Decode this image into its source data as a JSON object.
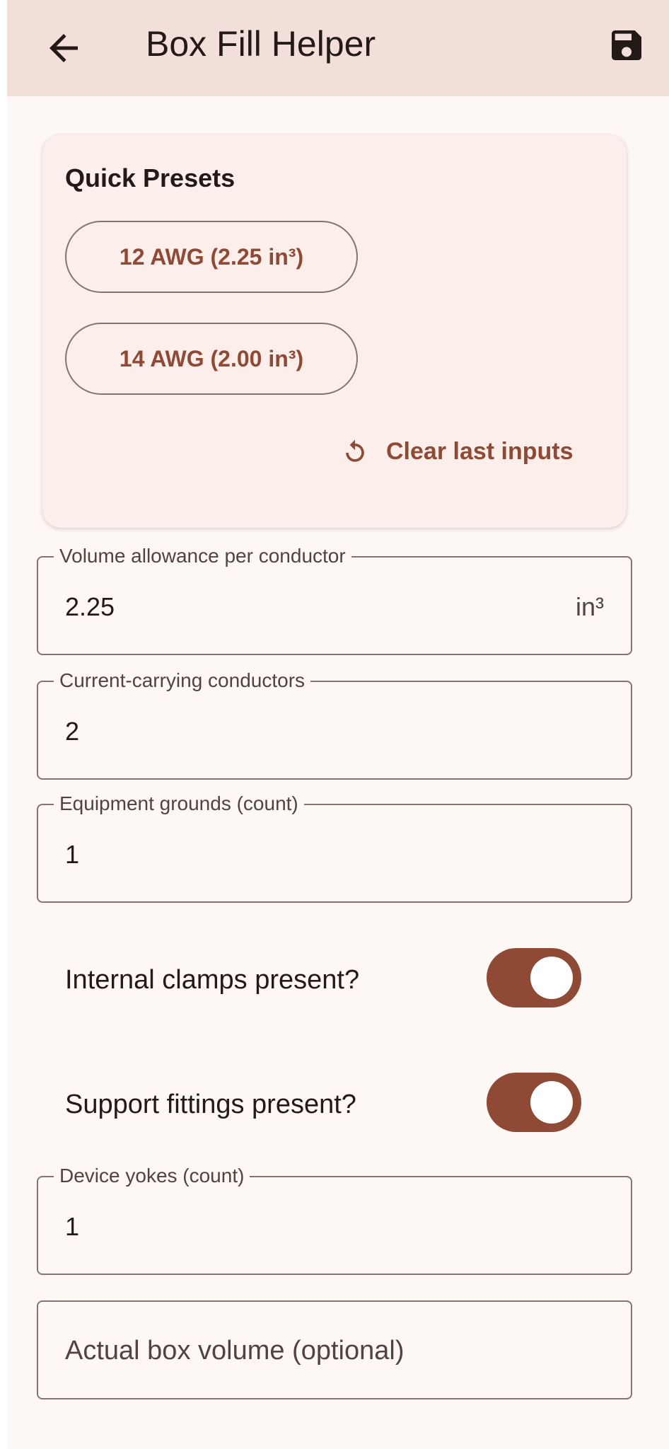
{
  "app_bar": {
    "title": "Box Fill Helper",
    "back_icon": "arrow-left-icon",
    "save_icon": "save-disk-icon"
  },
  "presets": {
    "title": "Quick Presets",
    "buttons": [
      {
        "label": "12 AWG (2.25 in³)"
      },
      {
        "label": "14 AWG (2.00 in³)"
      }
    ],
    "clear": {
      "icon": "refresh-icon",
      "label": "Clear last inputs"
    }
  },
  "fields": {
    "volume_allowance": {
      "label": "Volume allowance per conductor",
      "value": "2.25",
      "suffix": "in³"
    },
    "current_carrying": {
      "label": "Current-carrying conductors",
      "value": "2"
    },
    "equipment_grounds": {
      "label": "Equipment grounds (count)",
      "value": "1"
    },
    "device_yokes": {
      "label": "Device yokes (count)",
      "value": "1"
    },
    "actual_box_volume": {
      "placeholder": "Actual box volume (optional)",
      "value": ""
    }
  },
  "toggles": {
    "internal_clamps": {
      "label": "Internal clamps present?",
      "on": true
    },
    "support_fittings": {
      "label": "Support fittings present?",
      "on": true
    }
  },
  "colors": {
    "app_bar_bg": "#f2dfd9",
    "page_bg": "#fdf7f5",
    "card_bg": "#fceeeb",
    "accent": "#8f4a36",
    "outline": "#857370"
  }
}
